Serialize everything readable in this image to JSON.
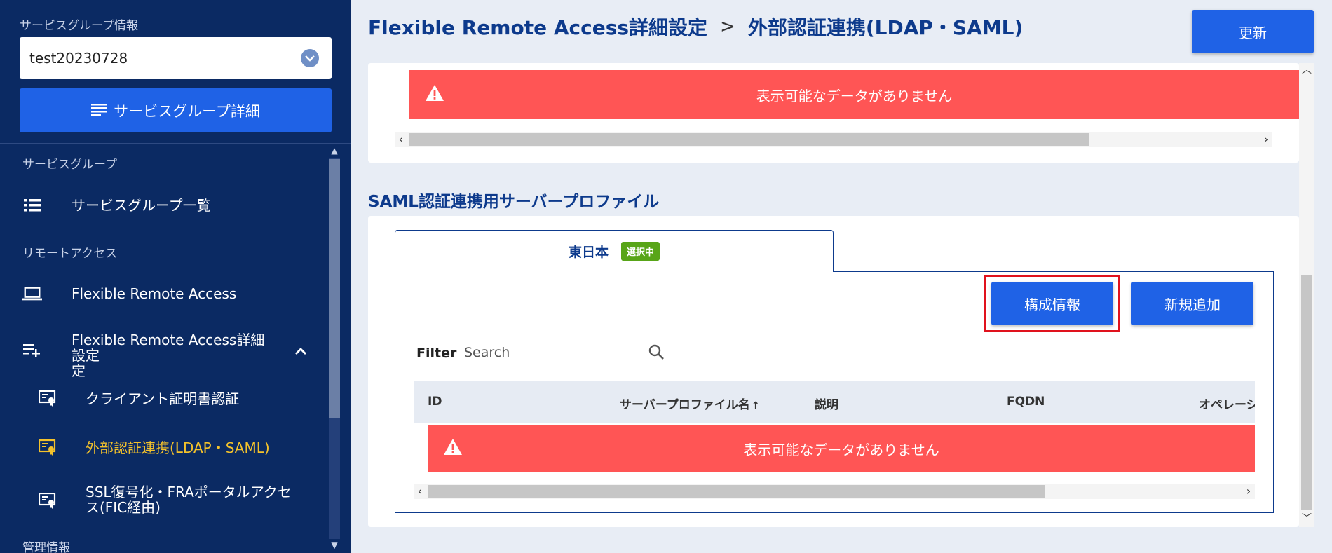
{
  "sidebar": {
    "service_group_info_label": "サービスグループ情報",
    "selected_group": "test20230728",
    "detail_button_label": "サービスグループ詳細",
    "sections": [
      {
        "label": "サービスグループ"
      },
      {
        "label": "リモートアクセス"
      },
      {
        "label": "管理情報"
      }
    ],
    "items": [
      {
        "label": "サービスグループ一覧",
        "icon": "list-icon"
      },
      {
        "label": "Flexible Remote Access",
        "icon": "laptop-icon"
      },
      {
        "label": "Flexible Remote Access詳細設定",
        "label_line2": "定",
        "icon": "playlist-add-icon"
      },
      {
        "label": "クライアント証明書認証",
        "icon": "certificate-icon"
      },
      {
        "label": "外部認証連携(LDAP・SAML)",
        "icon": "certificate-icon",
        "active": true
      },
      {
        "label": "SSL復号化・FRAポータルアクセ",
        "label_line2": "ス(FIC経由)",
        "icon": "certificate-icon"
      }
    ]
  },
  "header": {
    "breadcrumb_parent": "Flexible Remote Access詳細設定",
    "breadcrumb_separator": ">",
    "breadcrumb_current": "外部認証連携(LDAP・SAML)",
    "update_button": "更新"
  },
  "ldap_card": {
    "empty_message": "表示可能なデータがありません"
  },
  "saml_section": {
    "title": "SAML認証連携用サーバープロファイル",
    "tab_label": "東日本",
    "tab_badge": "選択中",
    "config_button": "構成情報",
    "new_button": "新規追加",
    "filter_label": "Filter",
    "search_placeholder": "Search",
    "columns": [
      "ID",
      "サーバープロファイル名",
      "説明",
      "FQDN",
      "オペレーシ"
    ],
    "sort_indicator": "↑",
    "empty_message": "表示可能なデータがありません"
  },
  "colors": {
    "sidebar_bg": "#0b2a63",
    "primary_button": "#1f62e6",
    "alert_bg": "#ff5555",
    "active_nav": "#f4c22b",
    "highlight_border": "#e0121d",
    "badge_green": "#58a518"
  }
}
